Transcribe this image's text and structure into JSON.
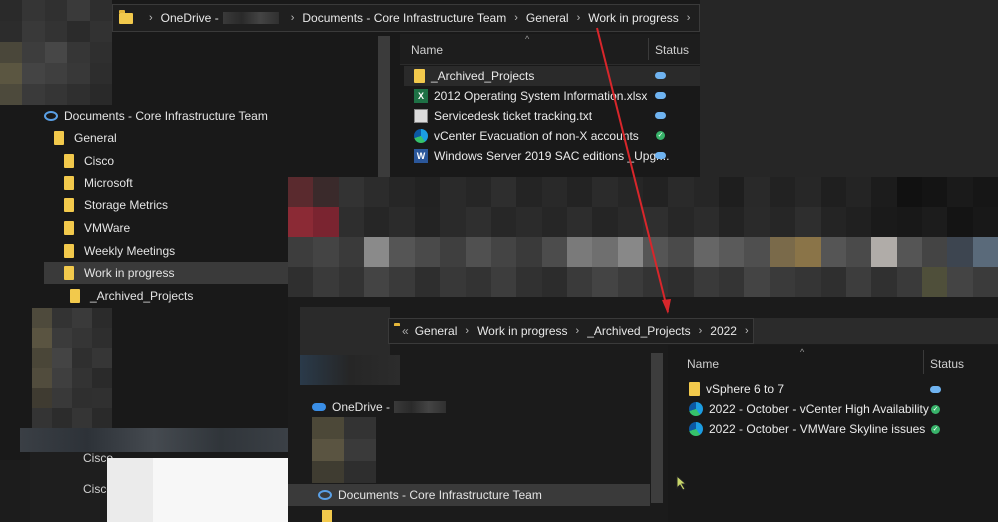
{
  "window1": {
    "breadcrumb": [
      "OneDrive -",
      "Documents - Core Infrastructure Team",
      "General",
      "Work in progress"
    ],
    "columns": {
      "name": "Name",
      "status": "Status"
    },
    "files": [
      {
        "name": "_Archived_Projects",
        "icon": "folder-icon",
        "status": "cloud"
      },
      {
        "name": "2012 Operating System Information.xlsx",
        "icon": "excel-icon",
        "status": "cloud"
      },
      {
        "name": "Servicedesk ticket tracking.txt",
        "icon": "text-file-icon",
        "status": "cloud"
      },
      {
        "name": "vCenter Evacuation of non-X accounts",
        "icon": "edge-icon",
        "status": "synced"
      },
      {
        "name": "Windows Server 2019 SAC editions _Upgr...",
        "icon": "word-icon",
        "status": "cloud"
      }
    ],
    "tree": [
      {
        "label": "Documents - Core Infrastructure Team",
        "icon": "sharepoint-library-icon"
      },
      {
        "label": "General",
        "icon": "folder-icon"
      },
      {
        "label": "Cisco",
        "icon": "folder-icon"
      },
      {
        "label": "Microsoft",
        "icon": "folder-icon"
      },
      {
        "label": "Storage Metrics",
        "icon": "folder-icon"
      },
      {
        "label": "VMWare",
        "icon": "folder-icon"
      },
      {
        "label": "Weekly Meetings",
        "icon": "folder-icon"
      },
      {
        "label": "Work in progress",
        "icon": "folder-icon",
        "selected": true
      },
      {
        "label": "_Archived_Projects",
        "icon": "folder-icon"
      }
    ],
    "background_labels": [
      "Cisco",
      "Cisco"
    ]
  },
  "window2": {
    "breadcrumb_prefix": "«",
    "breadcrumb": [
      "General",
      "Work in progress",
      "_Archived_Projects",
      "2022"
    ],
    "columns": {
      "name": "Name",
      "status": "Status"
    },
    "files": [
      {
        "name": "vSphere 6 to 7",
        "icon": "folder-icon",
        "status": "cloud"
      },
      {
        "name": "2022 - October - vCenter High Availability",
        "icon": "edge-icon",
        "status": "synced"
      },
      {
        "name": "2022 - October - VMWare Skyline issues",
        "icon": "edge-icon",
        "status": "synced"
      }
    ],
    "nav": {
      "onedrive_label": "OneDrive -",
      "library_label": "Documents - Core Infrastructure Team"
    }
  },
  "colors": {
    "annotation_arrow": "#d8262b",
    "folder": "#f2c94c",
    "synced": "#38b36a",
    "cloud": "#6fb3f0"
  }
}
